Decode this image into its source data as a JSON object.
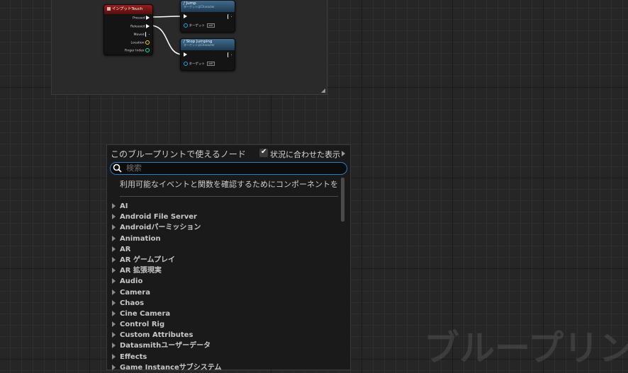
{
  "graph": {
    "input_touch_node": {
      "title": "インプットTouch",
      "pins": [
        "Pressed",
        "Released",
        "Moved",
        "Location",
        "Finger Index"
      ]
    },
    "jump_node": {
      "title": "Jump",
      "subtitle": "ターゲットはCharacter",
      "target_label": "ターゲット",
      "target_value": "self"
    },
    "stop_jumping_node": {
      "title": "Stop Jumping",
      "subtitle": "ターゲットはCharacter",
      "target_label": "ターゲット",
      "target_value": "self"
    },
    "watermark": "ブループリン"
  },
  "palette": {
    "title": "このブループリントで使えるノード",
    "context_sensitive_label": "状況に合わせた表示",
    "context_sensitive_checked": true,
    "search_placeholder": "検索",
    "hint": "利用可能なイベントと関数を確認するためにコンポーネントを選択",
    "categories": [
      "AI",
      "Android File Server",
      "Androidパーミッション",
      "Animation",
      "AR",
      "AR ゲームプレイ",
      "AR 拡張現実",
      "Audio",
      "Camera",
      "Chaos",
      "Cine Camera",
      "Control Rig",
      "Custom Attributes",
      "Datasmithユーザーデータ",
      "Effects",
      "Game Instanceサブシステム"
    ]
  },
  "colors": {
    "accent": "#2e7bc4",
    "event_header": "#9b1d1d",
    "function_header": "#3f6c8c",
    "location_pin": "#f5d016",
    "int_pin": "#1ee1a4",
    "object_pin": "#1ea5e6"
  }
}
